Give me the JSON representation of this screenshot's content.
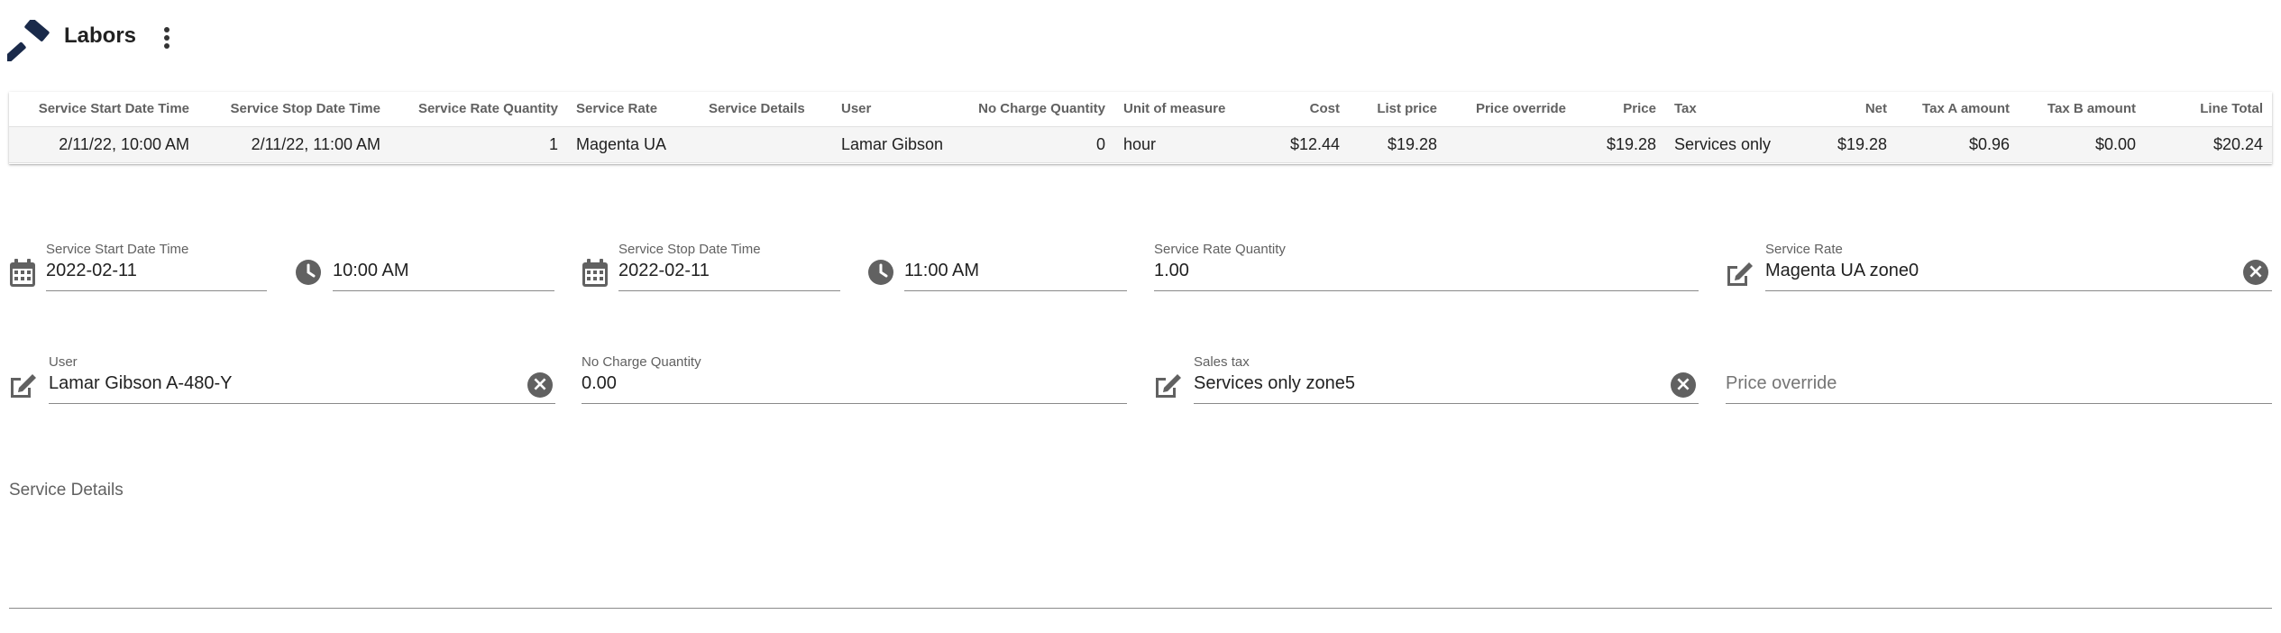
{
  "header": {
    "title": "Labors"
  },
  "table": {
    "columns": [
      "Service Start Date Time",
      "Service Stop Date Time",
      "Service Rate Quantity",
      "Service Rate",
      "Service Details",
      "User",
      "No Charge Quantity",
      "Unit of measure",
      "Cost",
      "List price",
      "Price override",
      "Price",
      "Tax",
      "Net",
      "Tax A amount",
      "Tax B amount",
      "Line Total"
    ],
    "rows": [
      [
        "2/11/22, 10:00 AM",
        "2/11/22, 11:00 AM",
        "1",
        "Magenta UA",
        "",
        "Lamar Gibson",
        "0",
        "hour",
        "$12.44",
        "$19.28",
        "",
        "$19.28",
        "Services only",
        "$19.28",
        "$0.96",
        "$0.00",
        "$20.24"
      ]
    ]
  },
  "form": {
    "start_date": {
      "label": "Service Start Date Time",
      "value": "2022-02-11"
    },
    "start_time": {
      "value": "10:00 AM"
    },
    "stop_date": {
      "label": "Service Stop Date Time",
      "value": "2022-02-11"
    },
    "stop_time": {
      "value": "11:00 AM"
    },
    "rate_quantity": {
      "label": "Service Rate Quantity",
      "value": "1.00"
    },
    "service_rate": {
      "label": "Service Rate",
      "value": "Magenta UA zone0"
    },
    "user": {
      "label": "User",
      "value": "Lamar Gibson A-480-Y"
    },
    "no_charge_quantity": {
      "label": "No Charge Quantity",
      "value": "0.00"
    },
    "sales_tax": {
      "label": "Sales tax",
      "value": "Services only zone5"
    },
    "price_override": {
      "placeholder": "Price override"
    },
    "service_details": {
      "label": "Service Details"
    }
  },
  "icons": {
    "header": "hammer-icon",
    "menu": "more-vert-icon",
    "date": "calendar-icon",
    "time": "clock-icon",
    "lookup": "edit-icon",
    "clear": "clear-icon"
  },
  "colors": {
    "brand": "#1a2a4a",
    "icon_grey": "#616161"
  }
}
